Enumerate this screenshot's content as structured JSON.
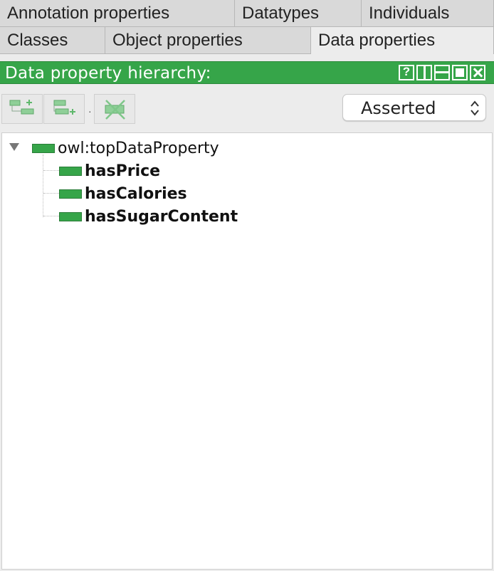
{
  "tabs_row1": [
    {
      "label": "Annotation properties",
      "selected": false
    },
    {
      "label": "Datatypes",
      "selected": false
    },
    {
      "label": "Individuals",
      "selected": false
    }
  ],
  "tabs_row2": [
    {
      "label": "Classes",
      "selected": false
    },
    {
      "label": "Object properties",
      "selected": false
    },
    {
      "label": "Data properties",
      "selected": true
    }
  ],
  "view": {
    "title": "Data property hierarchy:",
    "header_color": "#36a549",
    "header_buttons": [
      "help-icon",
      "split-vertical-icon",
      "split-horizontal-icon",
      "maximize-icon",
      "close-icon"
    ]
  },
  "toolbar": {
    "buttons": [
      "add-sub-property-icon",
      "add-sibling-property-icon",
      "delete-property-icon"
    ],
    "hierarchy_mode": "Asserted"
  },
  "tree": {
    "root": {
      "label": "owl:topDataProperty",
      "expanded": true
    },
    "children": [
      "hasPrice",
      "hasCalories",
      "hasSugarContent"
    ]
  }
}
